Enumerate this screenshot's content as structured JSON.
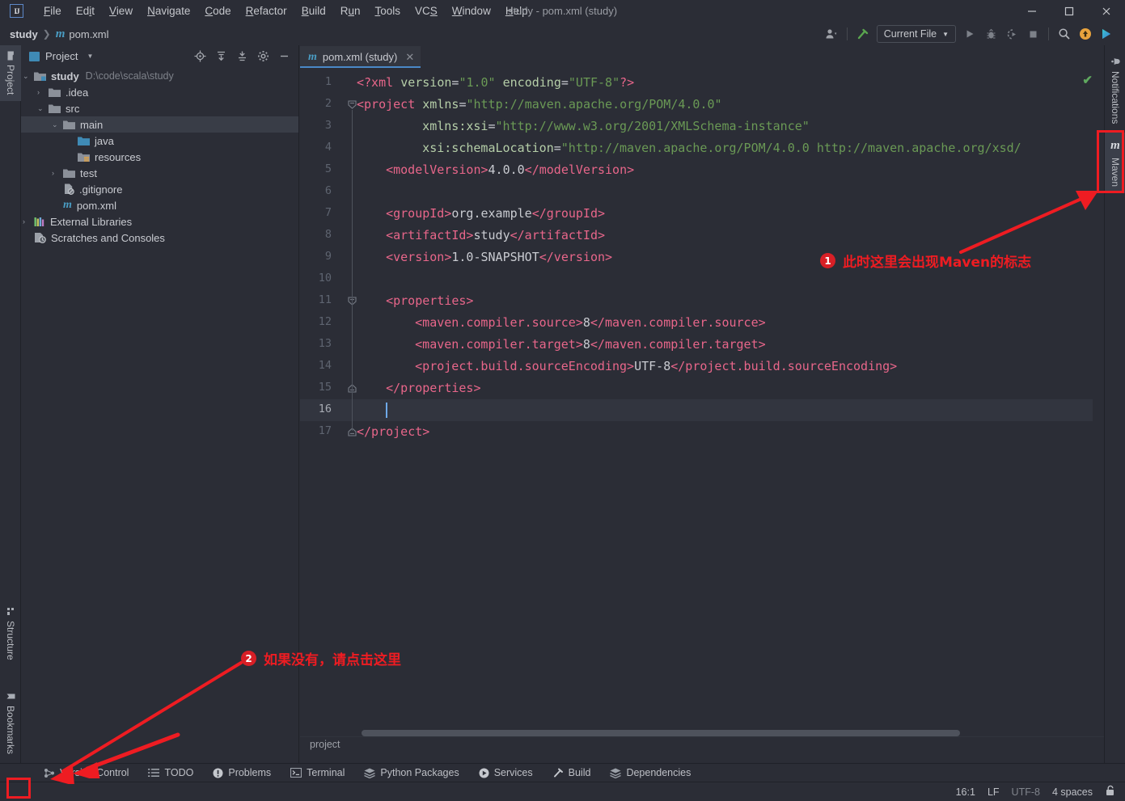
{
  "titlebar": {
    "app_icon": "intellij-idea-logo",
    "window_title": "study - pom.xml (study)",
    "menus": [
      "File",
      "Edit",
      "View",
      "Navigate",
      "Code",
      "Refactor",
      "Build",
      "Run",
      "Tools",
      "VCS",
      "Window",
      "Help"
    ],
    "minimize": "—",
    "maximize": "☐",
    "close": "✕"
  },
  "navbar": {
    "crumb_project": "study",
    "crumb_sep": "❯",
    "crumb_file": "pom.xml",
    "maven_glyph": "m",
    "run_config": "Current File",
    "icons": {
      "avatar": "user-avatar-icon",
      "build": "hammer-build-icon",
      "run": "run-icon",
      "debug": "debug-icon",
      "run_coverage": "run-with-coverage-icon",
      "stop": "stop-icon",
      "search": "search-everywhere-icon",
      "updates": "update-available-icon",
      "ai": "ai-assistant-icon"
    }
  },
  "left_strip": {
    "top_tabs": [
      {
        "label": "Project",
        "icon": "project-folder-icon",
        "active": true
      }
    ],
    "bottom_tabs": [
      {
        "label": "Structure",
        "icon": "structure-icon"
      },
      {
        "label": "Bookmarks",
        "icon": "bookmark-icon"
      }
    ]
  },
  "right_strip": {
    "tabs": [
      {
        "label": "Notifications",
        "icon": "bell-icon"
      },
      {
        "label": "Maven",
        "icon": "maven-m-icon"
      }
    ]
  },
  "project_panel": {
    "title": "Project",
    "toolbar_icons": [
      "locate-target-icon",
      "expand-all-icon",
      "collapse-all-icon",
      "gear-icon",
      "minimize-icon"
    ],
    "tree": [
      {
        "label": "study",
        "path": "D:\\code\\scala\\study",
        "arrow": "⌄",
        "depth": 0,
        "icon": "module-folder",
        "bold": true,
        "selected": false
      },
      {
        "label": ".idea",
        "path": "",
        "arrow": "›",
        "depth": 1,
        "icon": "folder",
        "bold": false,
        "selected": false
      },
      {
        "label": "src",
        "path": "",
        "arrow": "⌄",
        "depth": 1,
        "icon": "folder",
        "bold": false,
        "selected": false
      },
      {
        "label": "main",
        "path": "",
        "arrow": "⌄",
        "depth": 2,
        "icon": "folder",
        "bold": false,
        "selected": true
      },
      {
        "label": "java",
        "path": "",
        "arrow": "",
        "depth": 3,
        "icon": "source-folder",
        "bold": false,
        "selected": false
      },
      {
        "label": "resources",
        "path": "",
        "arrow": "",
        "depth": 3,
        "icon": "resource-folder",
        "bold": false,
        "selected": false
      },
      {
        "label": "test",
        "path": "",
        "arrow": "›",
        "depth": 2,
        "icon": "folder",
        "bold": false,
        "selected": false
      },
      {
        "label": ".gitignore",
        "path": "",
        "arrow": "",
        "depth": 2,
        "icon": "gitignore-file",
        "bold": false,
        "selected": false
      },
      {
        "label": "pom.xml",
        "path": "",
        "arrow": "",
        "depth": 2,
        "icon": "maven-file",
        "bold": false,
        "selected": false
      },
      {
        "label": "External Libraries",
        "path": "",
        "arrow": "›",
        "depth": 0,
        "icon": "libraries",
        "bold": false,
        "selected": false
      },
      {
        "label": "Scratches and Consoles",
        "path": "",
        "arrow": "",
        "depth": 0,
        "icon": "scratches",
        "bold": false,
        "selected": false
      }
    ]
  },
  "editor": {
    "tab": {
      "label": "pom.xml (study)",
      "icon": "maven-file-icon",
      "close": "✕"
    },
    "inspection_status": "✔",
    "breadcrumb": "project",
    "lines": [
      {
        "n": 1,
        "indent": 0,
        "fold": "",
        "segs": [
          {
            "t": "tag",
            "v": "<?xml "
          },
          {
            "t": "attr",
            "v": "version"
          },
          {
            "t": "txt",
            "v": "="
          },
          {
            "t": "str",
            "v": "\"1.0\""
          },
          {
            "t": "txt",
            "v": " "
          },
          {
            "t": "attr",
            "v": "encoding"
          },
          {
            "t": "txt",
            "v": "="
          },
          {
            "t": "str",
            "v": "\"UTF-8\""
          },
          {
            "t": "tag",
            "v": "?>"
          }
        ]
      },
      {
        "n": 2,
        "indent": 0,
        "fold": "open",
        "segs": [
          {
            "t": "tag",
            "v": "<project "
          },
          {
            "t": "attr",
            "v": "xmlns"
          },
          {
            "t": "txt",
            "v": "="
          },
          {
            "t": "str",
            "v": "\"http://maven.apache.org/POM/4.0.0\""
          }
        ]
      },
      {
        "n": 3,
        "indent": 9,
        "fold": "",
        "segs": [
          {
            "t": "attr",
            "v": "xmlns:xsi"
          },
          {
            "t": "txt",
            "v": "="
          },
          {
            "t": "str",
            "v": "\"http://www.w3.org/2001/XMLSchema-instance\""
          }
        ]
      },
      {
        "n": 4,
        "indent": 9,
        "fold": "",
        "segs": [
          {
            "t": "attr",
            "v": "xsi:schemaLocation"
          },
          {
            "t": "txt",
            "v": "="
          },
          {
            "t": "str",
            "v": "\"http://maven.apache.org/POM/4.0.0 http://maven.apache.org/xsd/"
          }
        ]
      },
      {
        "n": 5,
        "indent": 4,
        "fold": "",
        "segs": [
          {
            "t": "tag",
            "v": "<modelVersion>"
          },
          {
            "t": "txt",
            "v": "4.0.0"
          },
          {
            "t": "tag",
            "v": "</modelVersion>"
          }
        ]
      },
      {
        "n": 6,
        "indent": 0,
        "fold": "",
        "segs": []
      },
      {
        "n": 7,
        "indent": 4,
        "fold": "",
        "segs": [
          {
            "t": "tag",
            "v": "<groupId>"
          },
          {
            "t": "txt",
            "v": "org.example"
          },
          {
            "t": "tag",
            "v": "</groupId>"
          }
        ]
      },
      {
        "n": 8,
        "indent": 4,
        "fold": "",
        "segs": [
          {
            "t": "tag",
            "v": "<artifactId>"
          },
          {
            "t": "txt",
            "v": "study"
          },
          {
            "t": "tag",
            "v": "</artifactId>"
          }
        ]
      },
      {
        "n": 9,
        "indent": 4,
        "fold": "",
        "segs": [
          {
            "t": "tag",
            "v": "<version>"
          },
          {
            "t": "txt",
            "v": "1.0-SNAPSHOT"
          },
          {
            "t": "tag",
            "v": "</version>"
          }
        ]
      },
      {
        "n": 10,
        "indent": 0,
        "fold": "",
        "segs": []
      },
      {
        "n": 11,
        "indent": 4,
        "fold": "open",
        "segs": [
          {
            "t": "tag",
            "v": "<properties>"
          }
        ]
      },
      {
        "n": 12,
        "indent": 8,
        "fold": "",
        "segs": [
          {
            "t": "tag",
            "v": "<maven.compiler.source>"
          },
          {
            "t": "txt",
            "v": "8"
          },
          {
            "t": "tag",
            "v": "</maven.compiler.source>"
          }
        ]
      },
      {
        "n": 13,
        "indent": 8,
        "fold": "",
        "segs": [
          {
            "t": "tag",
            "v": "<maven.compiler.target>"
          },
          {
            "t": "txt",
            "v": "8"
          },
          {
            "t": "tag",
            "v": "</maven.compiler.target>"
          }
        ]
      },
      {
        "n": 14,
        "indent": 8,
        "fold": "",
        "segs": [
          {
            "t": "tag",
            "v": "<project.build.sourceEncoding>"
          },
          {
            "t": "txt",
            "v": "UTF-8"
          },
          {
            "t": "tag",
            "v": "</project.build.sourceEncoding>"
          }
        ]
      },
      {
        "n": 15,
        "indent": 4,
        "fold": "close",
        "segs": [
          {
            "t": "tag",
            "v": "</properties>"
          }
        ]
      },
      {
        "n": 16,
        "indent": 4,
        "fold": "",
        "segs": [],
        "current": true
      },
      {
        "n": 17,
        "indent": 0,
        "fold": "close",
        "segs": [
          {
            "t": "tag",
            "v": "</project>"
          }
        ]
      }
    ]
  },
  "bottom_toolwindows": [
    {
      "label": "Version Control",
      "icon": "version-control-icon"
    },
    {
      "label": "TODO",
      "icon": "todo-list-icon"
    },
    {
      "label": "Problems",
      "icon": "problems-icon"
    },
    {
      "label": "Terminal",
      "icon": "terminal-icon"
    },
    {
      "label": "Python Packages",
      "icon": "python-packages-icon"
    },
    {
      "label": "Services",
      "icon": "services-icon"
    },
    {
      "label": "Build",
      "icon": "build-hammer-icon"
    },
    {
      "label": "Dependencies",
      "icon": "dependencies-icon"
    }
  ],
  "statusbar": {
    "caret_position": "16:1",
    "line_separator": "LF",
    "encoding": "UTF-8",
    "indent": "4 spaces",
    "lock_icon": "read-only-lock-icon"
  },
  "annotations": [
    {
      "number": "1",
      "text": "此时这里会出现Maven的标志"
    },
    {
      "number": "2",
      "text": "如果没有，请点击这里"
    }
  ],
  "colors": {
    "accent_blue": "#4a88c7",
    "annotation_red": "#ee1c22",
    "xml_tag": "#e8668a",
    "xml_attr": "#b5cea8",
    "xml_string": "#6a9955",
    "editor_bg": "#2b2d36"
  }
}
